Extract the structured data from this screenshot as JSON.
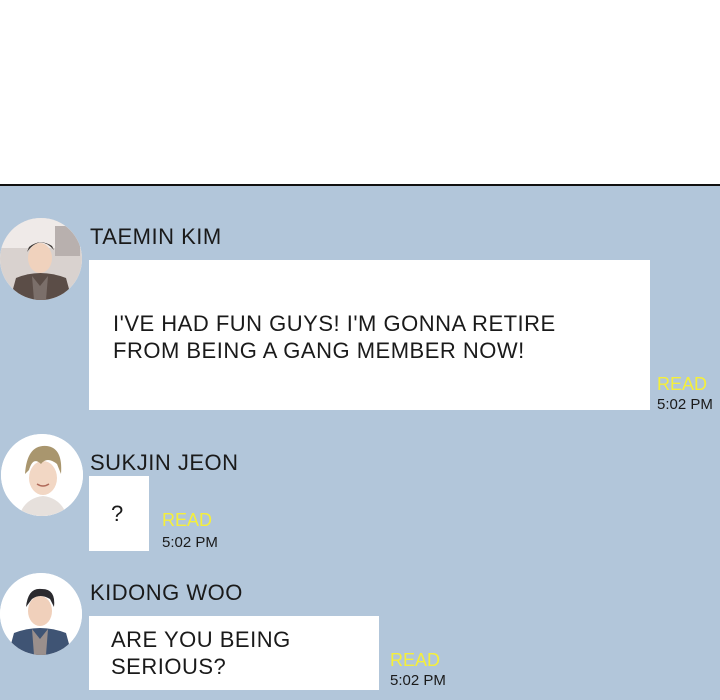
{
  "messages": [
    {
      "sender": "TAEMIN KIM",
      "text_lines": [
        "I'VE HAD FUN GUYS! I'M GONNA RETIRE",
        "FROM BEING A GANG MEMBER NOW!"
      ],
      "read": "READ",
      "time": "5:02 PM"
    },
    {
      "sender": "SUKJIN JEON",
      "text_lines": [
        "?"
      ],
      "read": "READ",
      "time": "5:02 PM"
    },
    {
      "sender": "KIDONG WOO",
      "text_lines": [
        "ARE YOU BEING",
        "SERIOUS?"
      ],
      "read": "READ",
      "time": "5:02 PM"
    }
  ],
  "colors": {
    "panel_bg": "#b2c6da",
    "bubble_bg": "#ffffff",
    "read_color": "#f5ef3a"
  }
}
